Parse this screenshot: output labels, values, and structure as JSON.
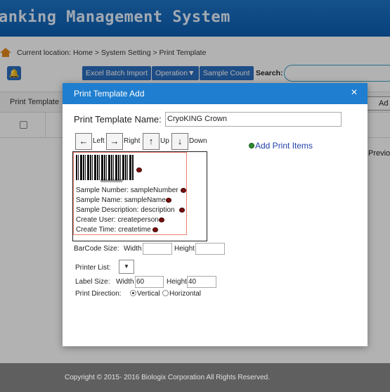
{
  "app": {
    "title": "anking Management System"
  },
  "breadcrumb": {
    "label": "Current location: Home > System Setting > Print Template"
  },
  "toolbar": {
    "excel_batch_import": "Excel Batch Import",
    "operation": "Operation▼",
    "sample_count": "Sample Count",
    "search_label": "Search:"
  },
  "grid": {
    "column_header": "Print Template",
    "add_button": "Ad",
    "pager_previous": "Previo"
  },
  "footer": {
    "copyright": "Copyright © 2015- 2016   Biologix Corporation All Rights Reserved."
  },
  "modal": {
    "title": "Print Template Add",
    "close_icon": "×",
    "name_label": "Print Template Name:",
    "name_value": "CryoKING Crown",
    "move": {
      "left": "Left",
      "right": "Right",
      "up": "Up",
      "down": "Down",
      "left_glyph": "←",
      "right_glyph": "→",
      "up_glyph": "↑",
      "down_glyph": "↓"
    },
    "add_items": "Add Print Items",
    "preview": {
      "barcode_number": "6666666666",
      "fields": [
        "Sample Number:  sampleNumber",
        "Sample Name:  sampleName",
        "Sample Description:  description",
        "Create User:  createperson",
        "Create Time:  createtime"
      ]
    },
    "barcode_size_label": "BarCode Size:",
    "width_label": "Width",
    "height_label": "Height",
    "barcode_width": "",
    "barcode_height": "",
    "printer_list_label": "Printer List:",
    "printer_select_glyph": "▼",
    "label_size_label": "Label Size:",
    "label_width": "60",
    "label_height": "40",
    "print_direction_label": "Print Direction:",
    "direction_options": [
      "Vertical",
      "Horizontal"
    ],
    "direction_selected": "Vertical"
  }
}
